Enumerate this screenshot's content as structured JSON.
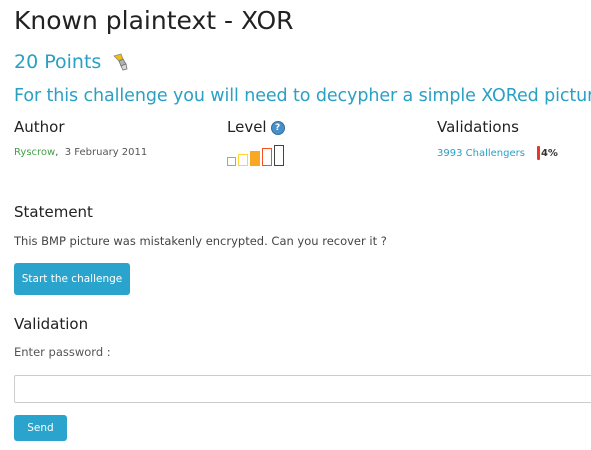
{
  "challenge": {
    "title": "Known plaintext - XOR",
    "points": "20 Points",
    "points_icon": "puzzle-pieces-icon",
    "subtitle": "For this challenge you will need to decypher a simple XORed picture."
  },
  "meta": {
    "author_heading": "Author",
    "author_name": "Ryscrow",
    "author_sep": ",",
    "author_date": "3 February 2011",
    "level_heading": "Level",
    "level_help_icon": "help-icon",
    "level": 3,
    "level_max": 5,
    "level_colors": [
      "#8bc34a",
      "#fdd835",
      "#f9a825",
      "#f4511e",
      "#444444"
    ],
    "validations_heading": "Validations",
    "validations_link": "3993 Challengers",
    "validations_percent_text": "4%",
    "validations_percent": 4,
    "validations_bar_color": "#e0392f"
  },
  "statement": {
    "heading": "Statement",
    "text": "This BMP picture was mistakenly encrypted. Can you recover it ?",
    "start_button": "Start the challenge"
  },
  "validation": {
    "heading": "Validation",
    "password_label": "Enter password :",
    "password_value": "",
    "send_button": "Send"
  },
  "colors": {
    "accent": "#29a0c4",
    "button": "#2aa4cc",
    "author": "#43a047"
  }
}
